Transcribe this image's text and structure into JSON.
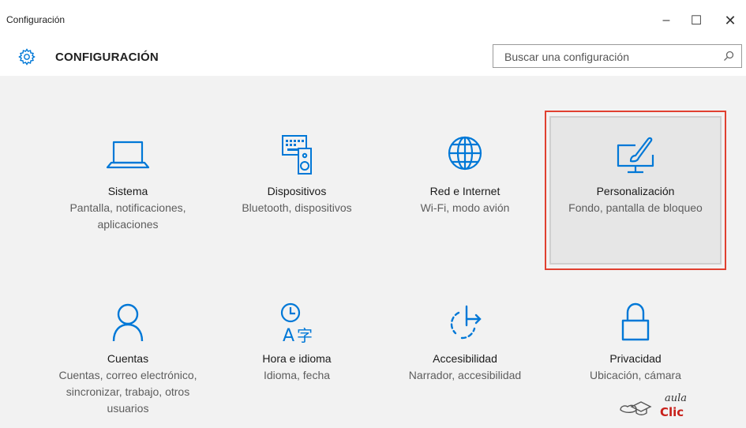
{
  "window": {
    "title": "Configuración",
    "controls": {
      "minimize": "–",
      "maximize": "☐",
      "close": "✕"
    }
  },
  "header": {
    "icon": "gear-icon",
    "title": "CONFIGURACIÓN"
  },
  "search": {
    "placeholder": "Buscar una configuración",
    "value": "",
    "icon": "search-icon"
  },
  "tiles": [
    {
      "name": "Sistema",
      "desc": "Pantalla, notificaciones, aplicaciones",
      "icon": "laptop-icon"
    },
    {
      "name": "Dispositivos",
      "desc": "Bluetooth, dispositivos",
      "icon": "devices-icon"
    },
    {
      "name": "Red e Internet",
      "desc": "Wi-Fi, modo avión",
      "icon": "globe-icon"
    },
    {
      "name": "Personalización",
      "desc": "Fondo, pantalla de bloqueo",
      "icon": "paintbrush-monitor-icon",
      "highlighted": true
    },
    {
      "name": "Cuentas",
      "desc": "Cuentas, correo electrónico, sincronizar, trabajo, otros usuarios",
      "icon": "person-icon"
    },
    {
      "name": "Hora e idioma",
      "desc": "Idioma, fecha",
      "icon": "clock-language-icon"
    },
    {
      "name": "Accesibilidad",
      "desc": "Narrador, accesibilidad",
      "icon": "accessibility-icon"
    },
    {
      "name": "Privacidad",
      "desc": "Ubicación, cámara",
      "icon": "lock-icon"
    }
  ],
  "watermark": {
    "text_top": "aula",
    "text_bottom": "Clic"
  },
  "colors": {
    "accent": "#0078d7",
    "highlight_border": "#e04030",
    "background": "#f2f2f2",
    "watermark_red": "#c8201a"
  }
}
